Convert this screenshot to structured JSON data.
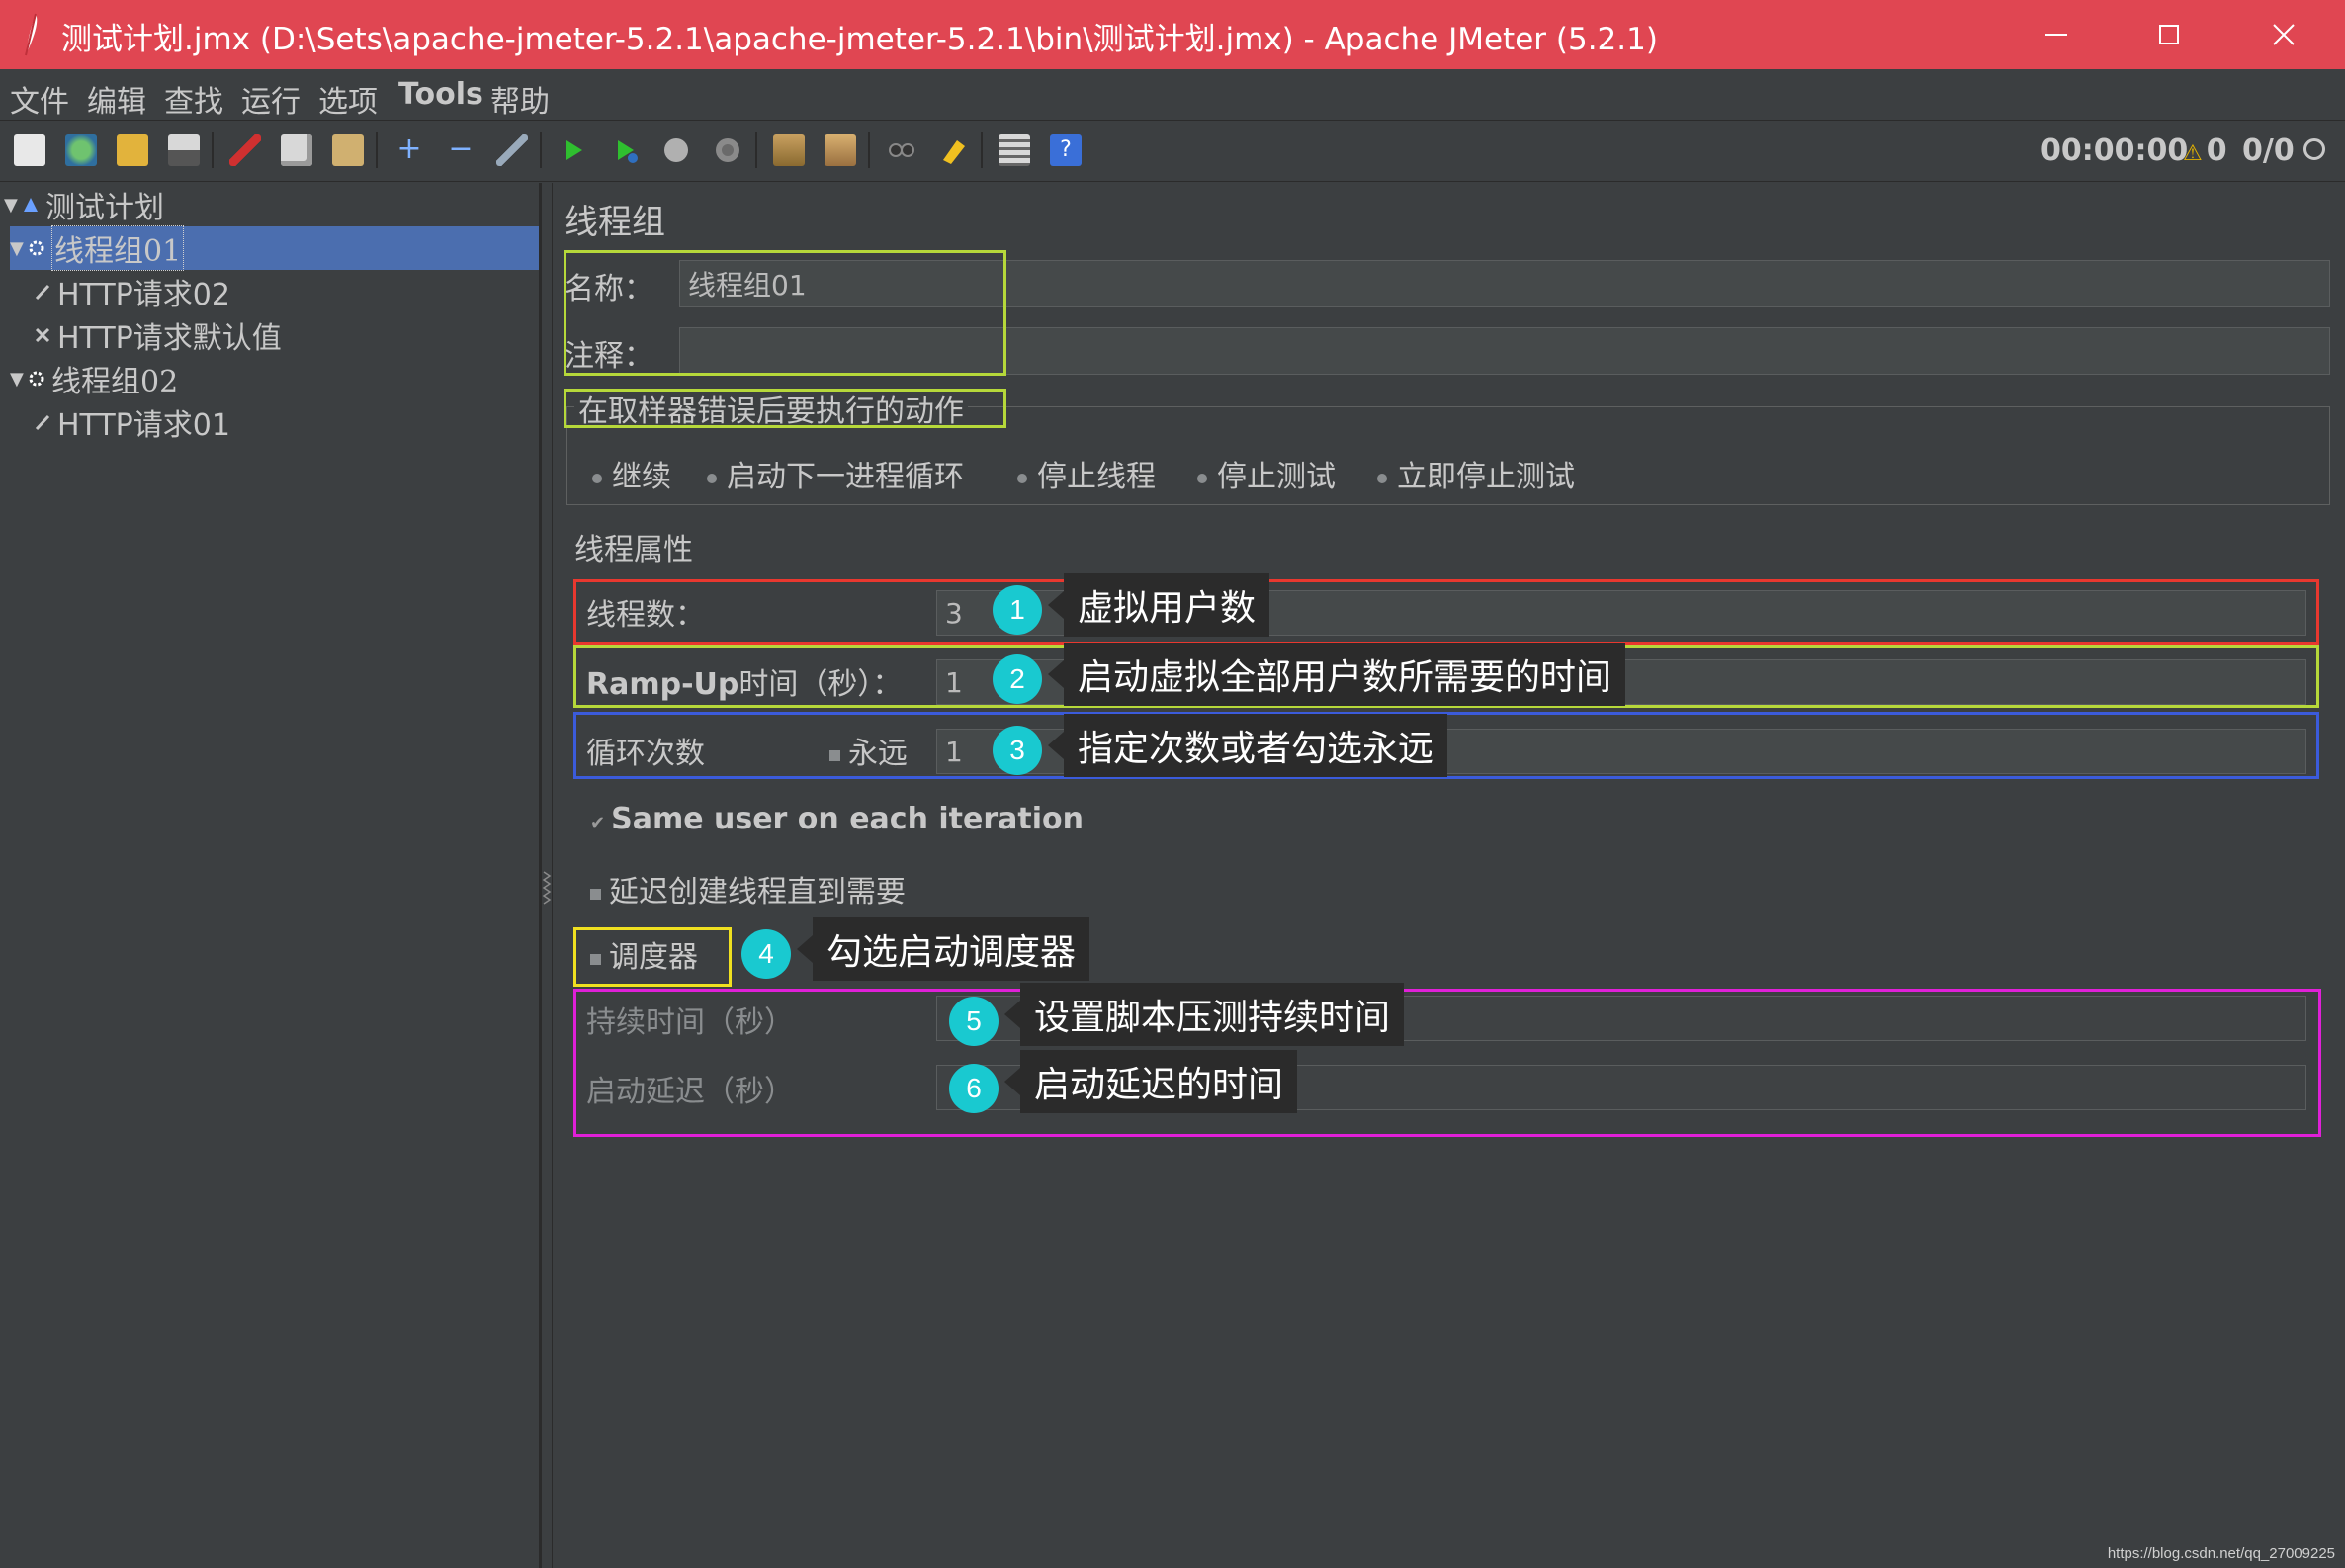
{
  "window": {
    "title": "测试计划.jmx (D:\\Sets\\apache-jmeter-5.2.1\\apache-jmeter-5.2.1\\bin\\测试计划.jmx) - Apache JMeter (5.2.1)",
    "title_bar_color": "#e04652"
  },
  "menu": {
    "items": [
      "文件",
      "编辑",
      "查找",
      "运行",
      "选项",
      "Tools",
      "帮助"
    ]
  },
  "toolbar": {
    "timer": "00:00:00",
    "warnings": "0",
    "threads": "0/0",
    "buttons": [
      "new-icon",
      "templates-icon",
      "open-icon",
      "save-icon",
      "cut-icon",
      "copy-icon",
      "paste-icon",
      "expand-icon",
      "collapse-icon",
      "toggle-icon",
      "start-icon",
      "start-no-pause-icon",
      "stop-icon",
      "shutdown-icon",
      "clear-icon",
      "clear-all-icon",
      "search-icon",
      "reset-search-icon",
      "function-helper-icon",
      "help-icon",
      "remote-icon"
    ]
  },
  "tree": {
    "items": [
      {
        "label": "测试计划",
        "level": 0,
        "icon": "test-plan-icon",
        "expanded": true,
        "selected": false
      },
      {
        "label": "线程组01",
        "level": 1,
        "icon": "thread-group-icon",
        "expanded": true,
        "selected": true
      },
      {
        "label": "HTTP请求02",
        "level": 2,
        "icon": "sampler-icon",
        "selected": false
      },
      {
        "label": "HTTP请求默认值",
        "level": 2,
        "icon": "config-icon",
        "selected": false
      },
      {
        "label": "线程组02",
        "level": 1,
        "icon": "thread-group-icon",
        "expanded": true,
        "selected": false
      },
      {
        "label": "HTTP请求01",
        "level": 2,
        "icon": "sampler-icon",
        "selected": false
      }
    ]
  },
  "panel": {
    "heading": "线程组",
    "name_label": "名称：",
    "name_value": "线程组01",
    "comment_label": "注释：",
    "comment_value": "",
    "error_action": {
      "title": "在取样器错误后要执行的动作",
      "options": [
        "继续",
        "启动下一进程循环",
        "停止线程",
        "停止测试",
        "立即停止测试"
      ]
    },
    "thread_props": {
      "title": "线程属性",
      "threads_label": "线程数：",
      "threads_value": "3",
      "rampup_label_bold": "Ramp-Up",
      "rampup_label_rest": "时间（秒）：",
      "rampup_value": "1",
      "loop_label": "循环次数",
      "forever_label": "永远",
      "loop_value": "1",
      "same_user_label": "Same user on each iteration",
      "delay_create_label": "延迟创建线程直到需要",
      "scheduler_label": "调度器",
      "duration_label": "持续时间（秒）",
      "duration_value": "",
      "startup_delay_label": "启动延迟（秒）",
      "startup_delay_value": ""
    }
  },
  "annotations": [
    {
      "number": "1",
      "text": "虚拟用户数"
    },
    {
      "number": "2",
      "text": "启动虚拟全部用户数所需要的时间"
    },
    {
      "number": "3",
      "text": "指定次数或者勾选永远"
    },
    {
      "number": "4",
      "text": "勾选启动调度器"
    },
    {
      "number": "5",
      "text": "设置脚本压测持续时间"
    },
    {
      "number": "6",
      "text": "启动延迟的时间"
    }
  ],
  "highlight_colors": {
    "name_box": "#b6d83a",
    "error_box": "#b6d83a",
    "threads_box": "#e8382f",
    "rampup_box": "#b6d83a",
    "loop_box": "#3b5bdb",
    "scheduler_box": "#f0e020",
    "scheduler_fields_box": "#e020d8",
    "badge": "#19c9d0"
  },
  "watermark": "https://blog.csdn.net/qq_27009225"
}
